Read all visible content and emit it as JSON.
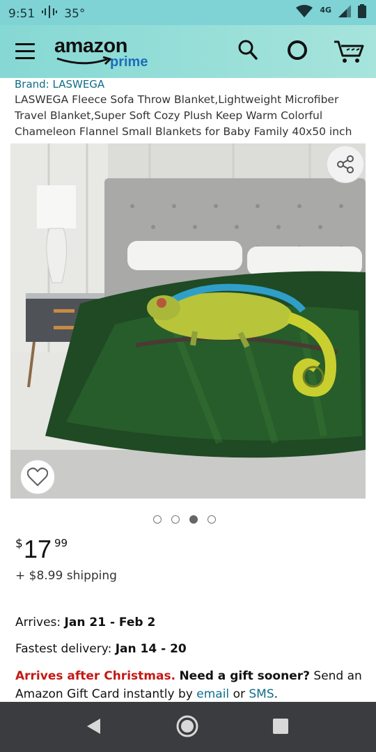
{
  "status_bar": {
    "time": "9:51",
    "temperature": "35°",
    "network": "4G",
    "icons": [
      "dialpad-icon",
      "wifi-icon",
      "signal-icon",
      "battery-icon"
    ]
  },
  "header": {
    "logo_text": "amazon",
    "logo_subtext": "prime",
    "icons": [
      "menu-icon",
      "search-icon",
      "alexa-icon",
      "cart-icon"
    ]
  },
  "product": {
    "brand": "Brand: LASWEGA",
    "title": "LASWEGA Fleece Sofa Throw Blanket,Lightweight Microfiber Travel Blanket,Super Soft Cozy Plush Keep Warm Colorful Chameleon Flannel Small Blankets for Baby Family 40x50 inch",
    "image_index": 3,
    "image_count": 4
  },
  "price": {
    "symbol": "$",
    "whole": "17",
    "cents": "99",
    "shipping": "+ $8.99 shipping"
  },
  "delivery": {
    "arrives_label": "Arrives: ",
    "arrives_dates": "Jan 21 - Feb 2",
    "fastest_label": "Fastest delivery: ",
    "fastest_dates": "Jan 14 - 20",
    "after_christmas": "Arrives after Christmas.",
    "gift_question": "Need a gift sooner?",
    "gift_text1": "Send an Amazon Gift Card instantly by",
    "email_link": "email",
    "or_text": "or",
    "sms_link": "SMS",
    "period": "."
  },
  "colors": {
    "status_bar": "#7fd3d5",
    "header": "#86d8d4",
    "link": "#0e6e8c",
    "alert_red": "#c41815",
    "nav_bar": "#3b3c3f"
  }
}
